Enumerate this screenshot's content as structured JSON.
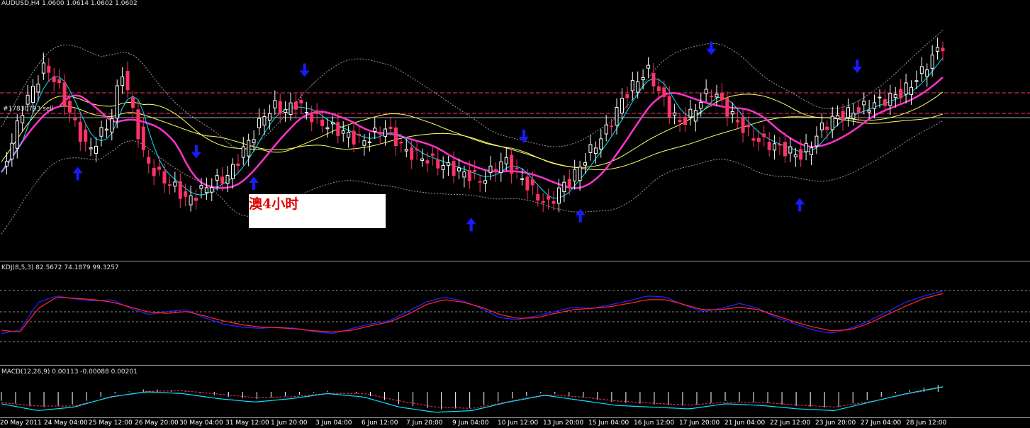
{
  "header": {
    "symbol_line": "AUDUSD,H4 1.0600 1.0614 1.0602 1.0602"
  },
  "order_label": "#17830793 sell",
  "annotation_text": "澳4小时",
  "kdj": {
    "title": "KDJ(8,5,3) 82.5672 74.1879 99.3257"
  },
  "macd": {
    "title": "MACD(12,26,9) 0.00113 -0.00088 0.00201"
  },
  "time_labels": [
    "20 May 2011",
    "24 May 04:00",
    "25 May 12:00",
    "26 May 20:00",
    "30 May 04:00",
    "31 May 12:00",
    "1 Jun 20:00",
    "3 Jun 04:00",
    "6 Jun 12:00",
    "7 Jun 20:00",
    "9 Jun 04:00",
    "10 Jun 12:00",
    "13 Jun 20:00",
    "15 Jun 04:00",
    "16 Jun 12:00",
    "17 Jun 20:00",
    "21 Jun 04:00",
    "22 Jun 12:00",
    "23 Jun 20:00",
    "27 Jun 04:00",
    "28 Jun 12:00"
  ],
  "colors": {
    "bull": "#ffffff",
    "bear": "#ff3366",
    "ma_fast": "#00e5ff",
    "ma_mid": "#ff33cc",
    "ma_slow": "#ffff66",
    "bollinger": "#9a9a9a",
    "arrow": "#1a1aff",
    "level_line": "#ff3366",
    "kdj_k": "#2222ff",
    "kdj_d": "#ff2222",
    "macd_line": "#00e5ff",
    "macd_signal": "#ff3366"
  },
  "chart_data": {
    "type": "candlestick",
    "price_series": [
      0.3,
      0.45,
      0.62,
      0.72,
      0.82,
      0.74,
      0.62,
      0.5,
      0.4,
      0.48,
      0.55,
      0.8,
      0.6,
      0.38,
      0.3,
      0.26,
      0.22,
      0.16,
      0.2,
      0.24,
      0.26,
      0.3,
      0.4,
      0.48,
      0.58,
      0.62,
      0.6,
      0.64,
      0.58,
      0.55,
      0.52,
      0.5,
      0.47,
      0.45,
      0.48,
      0.52,
      0.46,
      0.4,
      0.38,
      0.36,
      0.34,
      0.32,
      0.3,
      0.28,
      0.26,
      0.32,
      0.36,
      0.3,
      0.24,
      0.18,
      0.14,
      0.22,
      0.26,
      0.34,
      0.42,
      0.48,
      0.58,
      0.68,
      0.74,
      0.8,
      0.7,
      0.6,
      0.54,
      0.58,
      0.66,
      0.7,
      0.62,
      0.56,
      0.5,
      0.46,
      0.44,
      0.42,
      0.4,
      0.38,
      0.44,
      0.52,
      0.56,
      0.58,
      0.6,
      0.62,
      0.64,
      0.66,
      0.68,
      0.72,
      0.78,
      0.86,
      0.92
    ],
    "arrows_down": [
      0.207,
      0.322,
      0.555,
      0.754,
      0.909
    ],
    "arrows_up": [
      0.081,
      0.268,
      0.499,
      0.615,
      0.848
    ],
    "kdj_k": [
      0.2,
      0.25,
      0.7,
      0.8,
      0.75,
      0.72,
      0.74,
      0.6,
      0.5,
      0.55,
      0.58,
      0.45,
      0.35,
      0.3,
      0.28,
      0.3,
      0.28,
      0.22,
      0.2,
      0.28,
      0.35,
      0.4,
      0.55,
      0.7,
      0.78,
      0.72,
      0.6,
      0.45,
      0.42,
      0.48,
      0.55,
      0.62,
      0.6,
      0.66,
      0.72,
      0.8,
      0.78,
      0.65,
      0.55,
      0.6,
      0.68,
      0.6,
      0.45,
      0.35,
      0.25,
      0.2,
      0.28,
      0.4,
      0.55,
      0.7,
      0.8,
      0.88
    ],
    "kdj_d": [
      0.25,
      0.22,
      0.6,
      0.78,
      0.76,
      0.74,
      0.7,
      0.62,
      0.54,
      0.52,
      0.55,
      0.48,
      0.4,
      0.34,
      0.3,
      0.29,
      0.27,
      0.24,
      0.22,
      0.25,
      0.32,
      0.38,
      0.5,
      0.66,
      0.74,
      0.7,
      0.62,
      0.5,
      0.44,
      0.45,
      0.52,
      0.58,
      0.6,
      0.63,
      0.68,
      0.74,
      0.74,
      0.66,
      0.58,
      0.58,
      0.62,
      0.58,
      0.48,
      0.38,
      0.3,
      0.24,
      0.26,
      0.36,
      0.5,
      0.64,
      0.76,
      0.84
    ],
    "macd_line": [
      0.4,
      0.2,
      0.3,
      0.6,
      0.75,
      0.7,
      0.55,
      0.45,
      0.55,
      0.7,
      0.6,
      0.3,
      0.15,
      0.2,
      0.45,
      0.65,
      0.5,
      0.35,
      0.3,
      0.25,
      0.4,
      0.35,
      0.25,
      0.2,
      0.45,
      0.7,
      0.9
    ],
    "macd_signal": [
      0.35,
      0.25,
      0.25,
      0.5,
      0.68,
      0.7,
      0.6,
      0.5,
      0.52,
      0.62,
      0.62,
      0.4,
      0.22,
      0.18,
      0.38,
      0.58,
      0.52,
      0.4,
      0.33,
      0.28,
      0.36,
      0.36,
      0.28,
      0.22,
      0.38,
      0.6,
      0.8
    ]
  }
}
